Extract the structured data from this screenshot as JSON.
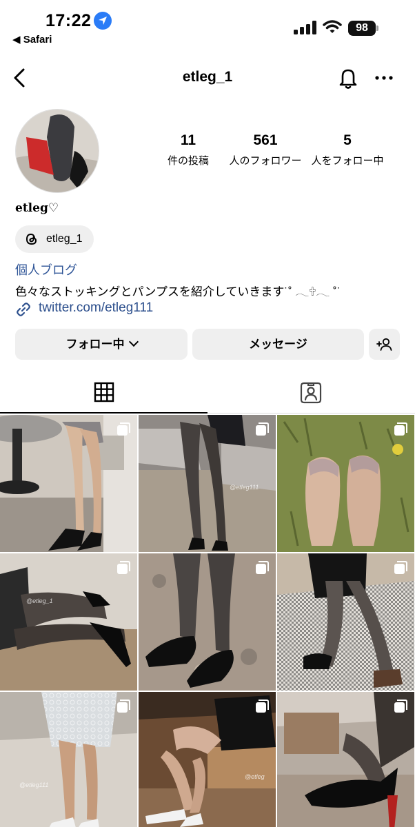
{
  "status_bar": {
    "time": "17:22",
    "back_app": "◀ Safari",
    "battery": "98",
    "icons": [
      "location-arrow-icon",
      "signal-icon",
      "wifi-icon",
      "battery-icon"
    ]
  },
  "nav": {
    "title": "etleg_1",
    "icons": [
      "back-chevron-icon",
      "bell-icon",
      "more-icon"
    ]
  },
  "profile": {
    "stats": [
      {
        "count": "11",
        "label": "件の投稿"
      },
      {
        "count": "561",
        "label": "人のフォロワー"
      },
      {
        "count": "5",
        "label": "人をフォロー中"
      }
    ],
    "display_name": "etleg♡",
    "threads_label": "etleg_1",
    "category": "個人ブログ",
    "bio": "色々なストッキングとパンプスを紹介していきます˙˚ 𓂃🕆𓂃 ˚˙",
    "link": "twitter.com/etleg111"
  },
  "actions": {
    "follow_label": "フォロー中",
    "message_label": "メッセージ",
    "add_user_label": "+👤"
  },
  "tabs": {
    "icons": [
      "grid-icon",
      "tagged-icon"
    ],
    "active": "grid"
  },
  "grid": {
    "posts": [
      {
        "watermark": ""
      },
      {
        "watermark": "@etleg111"
      },
      {
        "watermark": ""
      },
      {
        "watermark": "@etleg_1"
      },
      {
        "watermark": ""
      },
      {
        "watermark": ""
      },
      {
        "watermark": "@etleg111"
      },
      {
        "watermark": "@etleg"
      },
      {
        "watermark": ""
      }
    ]
  },
  "colors": {
    "location_badge": "#2a7cf7",
    "link": "#2b4e8c",
    "category": "#2f5597",
    "button_bg": "#efefef",
    "divider": "#dbdbdb"
  }
}
